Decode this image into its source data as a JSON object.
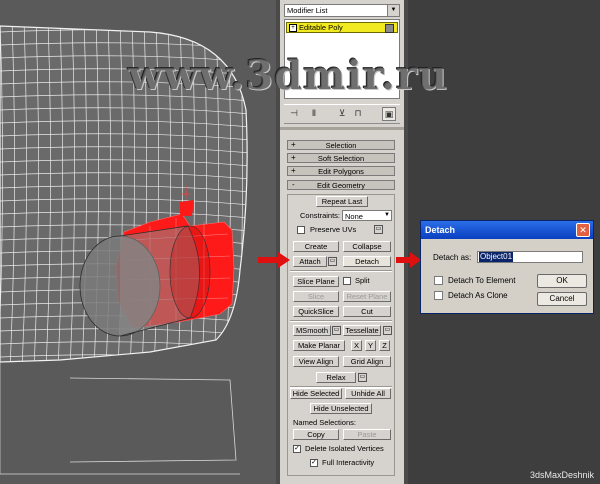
{
  "colors": {
    "selection_red": "#ff1a1a",
    "stack_highlight": "#f2ea20",
    "panel_bg": "#d6d3ce",
    "dialog_title": "#0a3fbf",
    "viewport_bg": "#5a5a5a"
  },
  "watermark": {
    "text": "www.3dmir.ru"
  },
  "brand": {
    "text": "3dsMaxDeshnik"
  },
  "modifier_panel": {
    "dropdown_value": "Modifier List",
    "stack_item": "Editable Poly"
  },
  "rollouts": {
    "selection": "Selection",
    "soft_selection": "Soft Selection",
    "edit_polygons": "Edit Polygons",
    "edit_geometry": "Edit Geometry",
    "plus": "+",
    "minus": "-"
  },
  "edit_geometry": {
    "repeat_last": "Repeat Last",
    "constraints_label": "Constraints:",
    "constraints_value": "None",
    "preserve_uvs": "Preserve UVs",
    "create": "Create",
    "collapse": "Collapse",
    "attach": "Attach",
    "detach": "Detach",
    "slice_plane": "Slice Plane",
    "split": "Split",
    "slice": "Slice",
    "reset_plane": "Reset Plane",
    "quickslice": "QuickSlice",
    "cut": "Cut",
    "msmooth": "MSmooth",
    "tessellate": "Tessellate",
    "make_planar": "Make Planar",
    "x": "X",
    "y": "Y",
    "z": "Z",
    "view_align": "View Align",
    "grid_align": "Grid Align",
    "relax": "Relax",
    "hide_selected": "Hide Selected",
    "unhide_all": "Unhide All",
    "hide_unselected": "Hide Unselected",
    "named_selections": "Named Selections:",
    "copy": "Copy",
    "paste": "Paste",
    "delete_isolated": "Delete Isolated Vertices",
    "full_interactivity": "Full Interactivity"
  },
  "dialog": {
    "title": "Detach",
    "close": "✕",
    "detach_as_label": "Detach as:",
    "detach_as_value": "Object01",
    "detach_to_element": "Detach To Element",
    "detach_as_clone": "Detach As Clone",
    "ok": "OK",
    "cancel": "Cancel"
  }
}
